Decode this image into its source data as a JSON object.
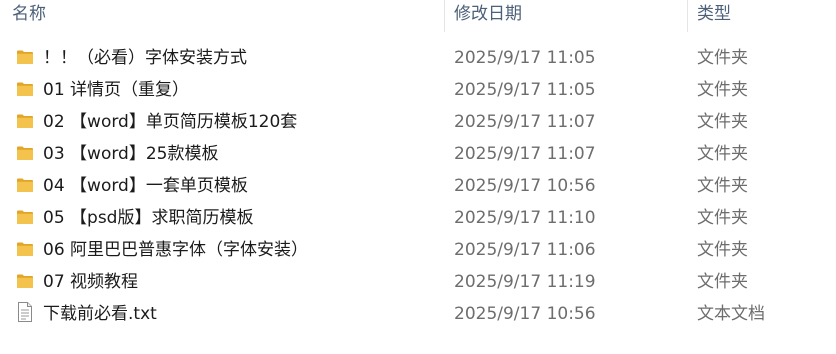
{
  "columns": {
    "name": "名称",
    "date": "修改日期",
    "type": "类型"
  },
  "colors": {
    "folder": "#f4c34d",
    "folder_dark": "#e2a528",
    "header_text": "#4c607a",
    "text": "#1b1b1b",
    "secondary_text": "#6d6d6d"
  },
  "files": [
    {
      "icon": "folder-icon",
      "name": "！！（必看）字体安装方式",
      "date": "2025/9/17 11:05",
      "type": "文件夹"
    },
    {
      "icon": "folder-icon",
      "name": "01 详情页（重复）",
      "date": "2025/9/17 11:05",
      "type": "文件夹"
    },
    {
      "icon": "folder-icon",
      "name": "02 【word】单页简历模板120套",
      "date": "2025/9/17 11:07",
      "type": "文件夹"
    },
    {
      "icon": "folder-icon",
      "name": "03 【word】25款模板",
      "date": "2025/9/17 11:07",
      "type": "文件夹"
    },
    {
      "icon": "folder-icon",
      "name": "04 【word】一套单页模板",
      "date": "2025/9/17 10:56",
      "type": "文件夹"
    },
    {
      "icon": "folder-icon",
      "name": "05 【psd版】求职简历模板",
      "date": "2025/9/17 11:10",
      "type": "文件夹"
    },
    {
      "icon": "folder-icon",
      "name": "06 阿里巴巴普惠字体（字体安装）",
      "date": "2025/9/17 11:06",
      "type": "文件夹"
    },
    {
      "icon": "folder-icon",
      "name": "07 视频教程",
      "date": "2025/9/17 11:19",
      "type": "文件夹"
    },
    {
      "icon": "text-file-icon",
      "name": "下载前必看.txt",
      "date": "2025/9/17 10:56",
      "type": "文本文档"
    }
  ]
}
